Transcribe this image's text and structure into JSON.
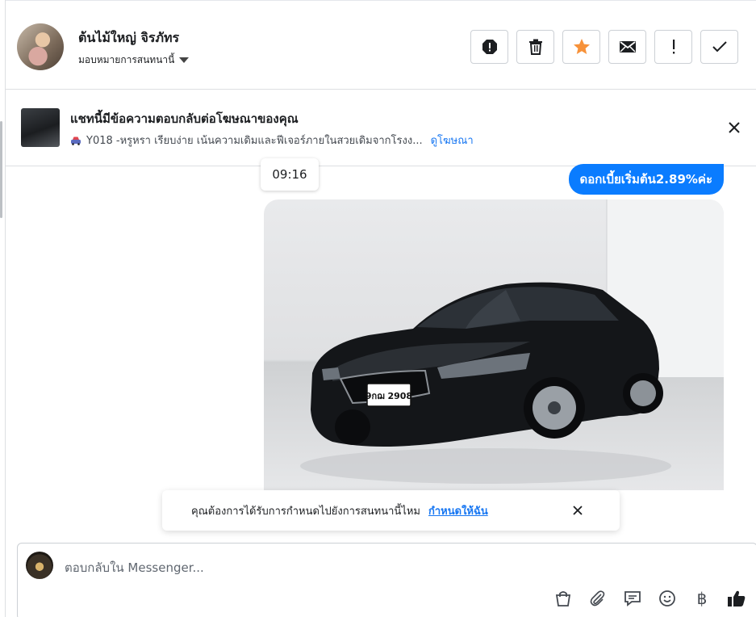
{
  "header": {
    "user_name": "ต้นไม้ใหญ่ จิรภัทร",
    "assign_label": "มอบหมายการสนทนานี้",
    "actions": [
      {
        "icon": "report-icon"
      },
      {
        "icon": "trash-icon"
      },
      {
        "icon": "star-icon",
        "color": "#f7923a"
      },
      {
        "icon": "mail-icon"
      },
      {
        "icon": "exclamation-icon"
      },
      {
        "icon": "check-icon"
      }
    ]
  },
  "ad_notice": {
    "title": "แชทนี้มีข้อความตอบกลับต่อโฆษณาของคุณ",
    "description": "Y018 -หรูหรา เรียบง่าย เน้นความเดิมและฟีเจอร์ภายในสวยเดิมจากโรงง...",
    "link": "ดูโฆษณา",
    "car_icon": "car-icon"
  },
  "chat": {
    "timestamp": "09:16",
    "message": "ดอกเบี้ยเริ่มต้น2.89%ค่ะ",
    "plate": "9กฌ 2908",
    "accent": "#0a7cff"
  },
  "assign_toast": {
    "text": "คุณต้องการได้รับการกำหนดไปยังการสนทนานี้ไหม",
    "link": "กำหนดให้ฉัน"
  },
  "composer": {
    "placeholder": "ตอบกลับใน Messenger...",
    "tools": [
      "shop-bag-icon",
      "paperclip-icon",
      "saved-reply-icon",
      "emoji-icon",
      "baht-icon",
      "like-icon"
    ],
    "baht_symbol": "฿"
  }
}
